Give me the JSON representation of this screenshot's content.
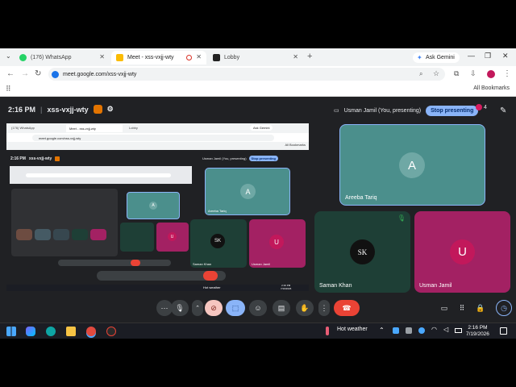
{
  "browser": {
    "tabs": [
      {
        "label": "(176) WhatsApp",
        "active": false
      },
      {
        "label": "Meet - xss-vxjj-wty",
        "active": true
      },
      {
        "label": "Lobby",
        "active": false
      }
    ],
    "ask_gemini": "Ask Gemini",
    "url": "meet.google.com/xss-vxjj-wty",
    "all_bookmarks": "All Bookmarks"
  },
  "meet": {
    "time": "2:16 PM",
    "meeting_code": "xss-vxjj-wty",
    "presenting_label": "Usman Jamil (You, presenting)",
    "stop_presenting": "Stop presenting",
    "participants_count": "4",
    "tiles": [
      {
        "name": "Areeba Tariq",
        "initial": "A",
        "color": "#4b8f8c"
      },
      {
        "name": "Saman Khan",
        "initial": "SK",
        "color": "#1e3f36"
      },
      {
        "name": "Usman Jamil",
        "initial": "U",
        "color": "#a32163"
      }
    ]
  },
  "shared_screen": {
    "tabs": [
      "(176) WhatsApp",
      "Meet - xss-vxjj-wty",
      "Lobby"
    ],
    "ask_gemini": "Ask Gemini",
    "url": "meet.google.com/xss-vxjj-wty",
    "all_bookmarks": "All Bookmarks",
    "time": "2:16 PM",
    "meeting_code": "xss-vxjj-wty",
    "presenting_label": "Usman Jamil (You, presenting)",
    "stop_presenting": "Stop presenting",
    "tiles": [
      {
        "name": "Areeba Tariq",
        "initial": "A"
      },
      {
        "name": "Saman Khan",
        "initial": "SK"
      },
      {
        "name": "Usman Jamil",
        "initial": "U"
      }
    ],
    "weather": "Hot weather",
    "clock_time": "2:16 PM",
    "clock_date": "7/19/2026"
  },
  "taskbar": {
    "weather": "Hot weather",
    "time": "2:16 PM",
    "date": "7/19/2026"
  },
  "colors": {
    "accent": "#8ab4f8",
    "end_call": "#ea4335",
    "meet_bg": "#202124"
  }
}
